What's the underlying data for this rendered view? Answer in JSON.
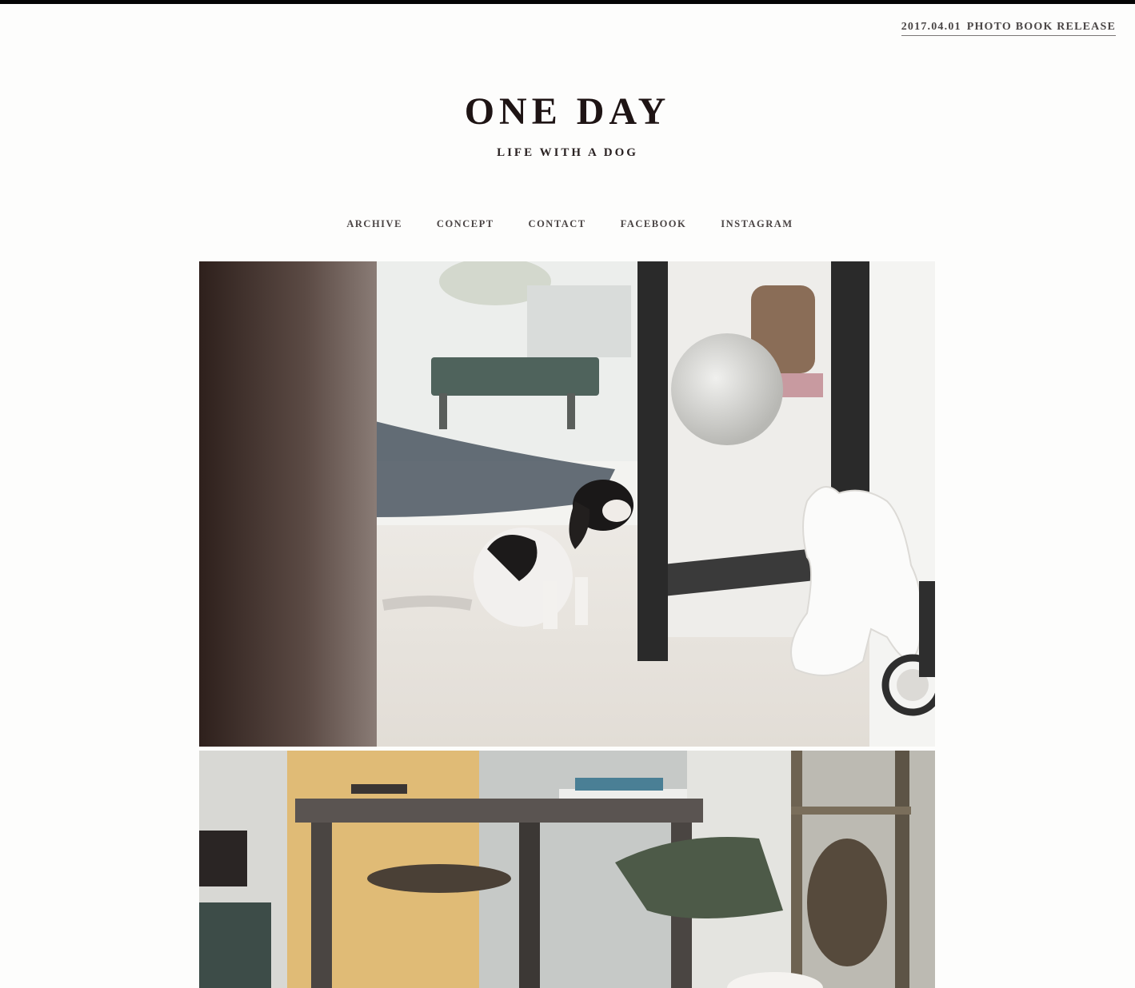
{
  "header": {
    "release_date": "2017.04.01",
    "release_label": "PHOTO BOOK RELEASE",
    "site_title": "ONE DAY",
    "tagline": "LIFE WITH A DOG"
  },
  "nav": {
    "items": [
      "ARCHIVE",
      "CONCEPT",
      "CONTACT",
      "FACEBOOK",
      "INSTAGRAM"
    ]
  },
  "colors": {
    "top_bar": "#050505",
    "title": "#1e1414",
    "nav_text": "#4a4444"
  }
}
